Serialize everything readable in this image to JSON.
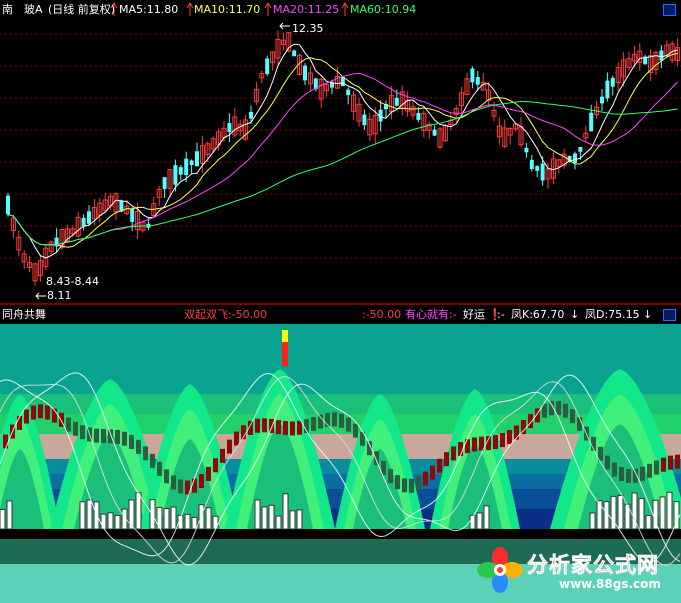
{
  "stock": {
    "name": "南　玻A",
    "period": "(日线 前复权)"
  },
  "ma": [
    {
      "label": "MA5:11.80",
      "color": "#ffffff"
    },
    {
      "label": "MA10:11.70",
      "color": "#ffff55"
    },
    {
      "label": "MA20:11.25",
      "color": "#ff44ff"
    },
    {
      "label": "MA60:10.94",
      "color": "#33ff66"
    }
  ],
  "annotations": {
    "high": "12.35",
    "low_range": "8.43-8.44",
    "low": "8.11"
  },
  "indicator": {
    "name": "同舟共舞",
    "signal1": "双起双飞:-50.00",
    "signal2": ":-50.00",
    "signal3": "有心就有:-",
    "signal4": "好运",
    "signal5": ":-",
    "fk": "凤K:67.70",
    "fd": "凤D:75.15"
  },
  "watermark": {
    "title": "分析家公式网",
    "url": "www.88gs.com"
  },
  "colors": {
    "up": "#ff3c3c",
    "down": "#54ffff",
    "ma5": "#ffffff",
    "ma10": "#ffff55",
    "ma20": "#ff44ff",
    "ma60": "#33ff66",
    "sub_bg": "#0aa391"
  }
}
